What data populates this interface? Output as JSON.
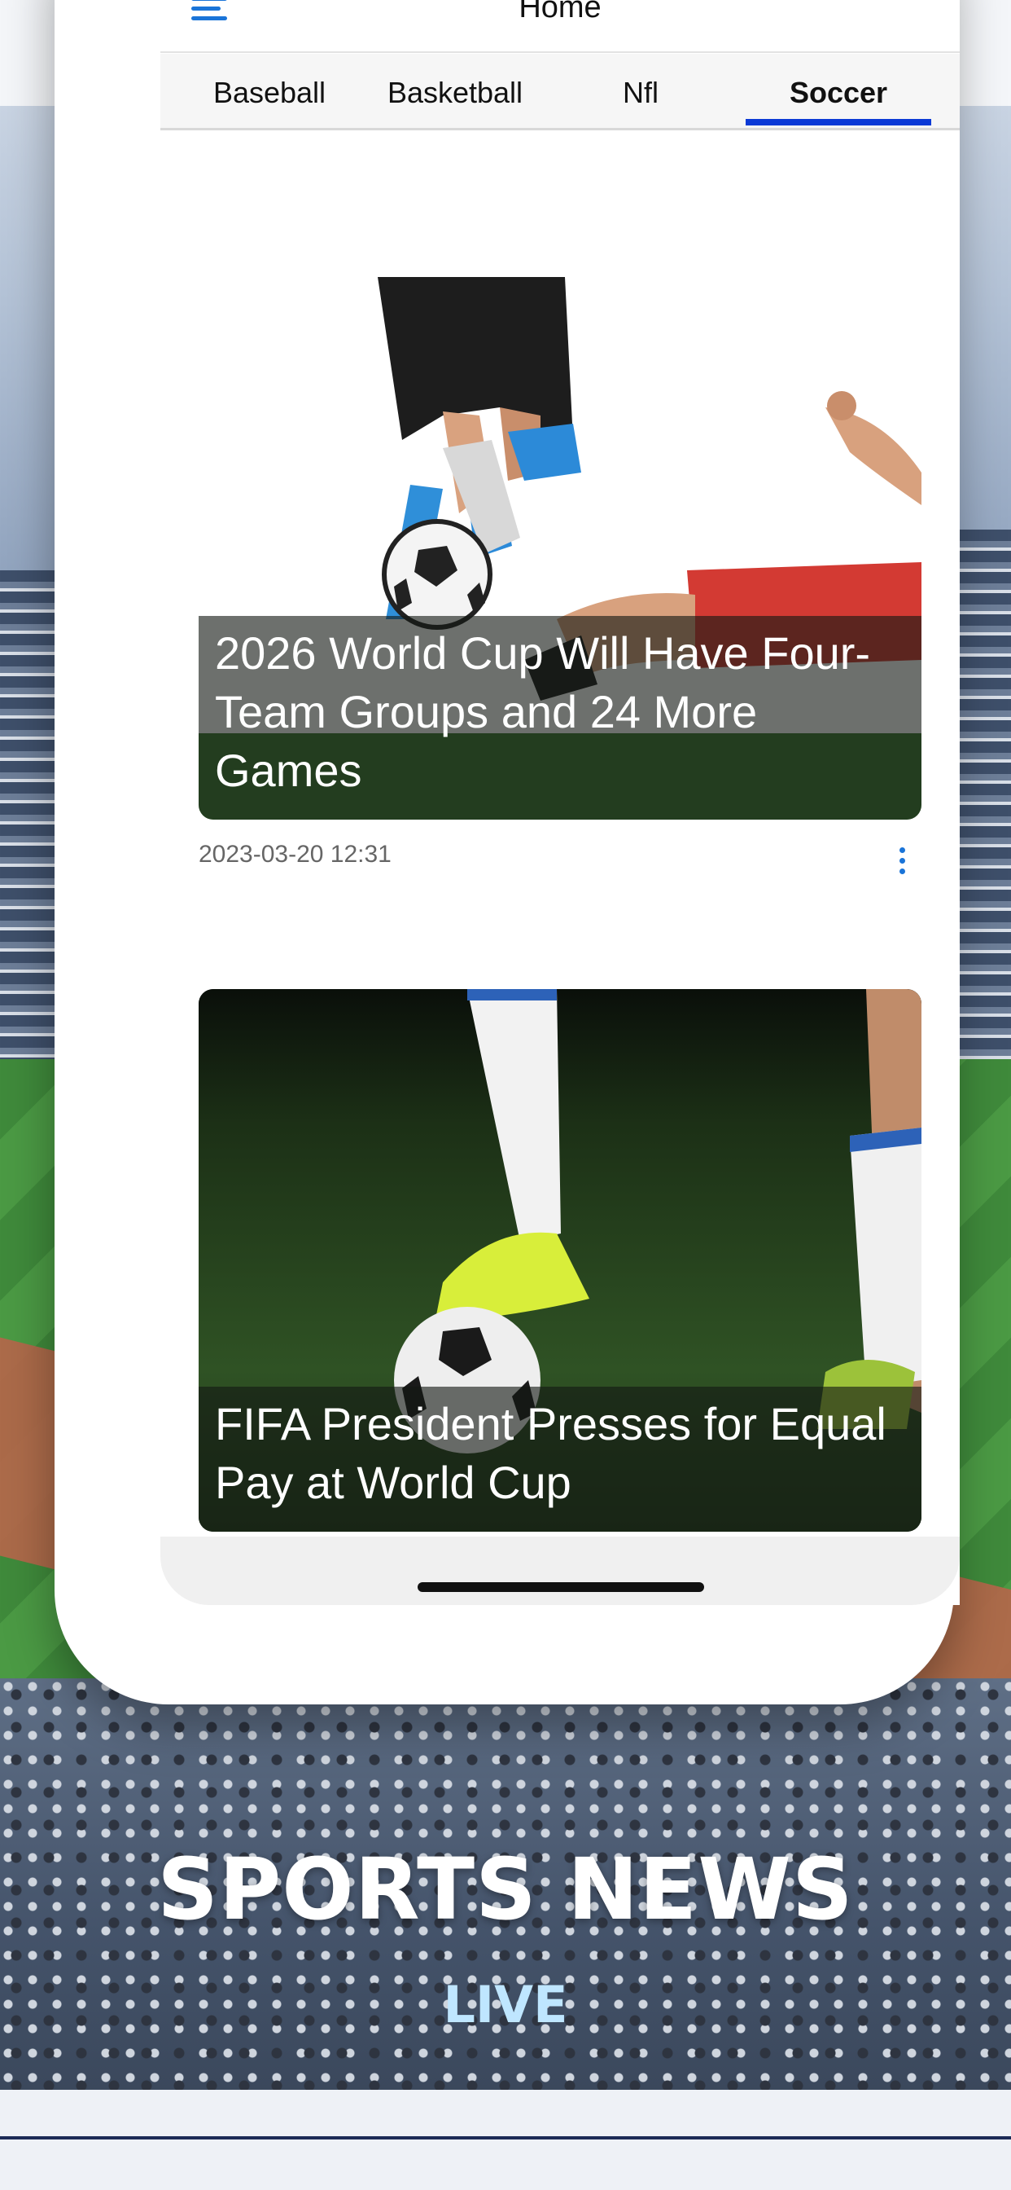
{
  "header": {
    "title": "Home",
    "menu_icon": "menu-icon"
  },
  "tabs": [
    {
      "label": "Baseball",
      "active": false
    },
    {
      "label": "Basketball",
      "active": false
    },
    {
      "label": "Nfl",
      "active": false
    },
    {
      "label": "Soccer",
      "active": true
    }
  ],
  "articles": [
    {
      "headline": "2026 World Cup Will Have Four-Team Groups and 24 More Games",
      "timestamp": "2023-03-20 12:31",
      "more_icon": "more-vertical-icon"
    },
    {
      "headline": "FIFA President Presses for Equal Pay at World Cup"
    }
  ],
  "promo": {
    "title": "SPORTS NEWS",
    "subtitle": "LIVE"
  },
  "colors": {
    "accent": "#1a74d8",
    "tab_indicator": "#0b3ad6",
    "promo_subtitle": "#bfe6ff"
  }
}
